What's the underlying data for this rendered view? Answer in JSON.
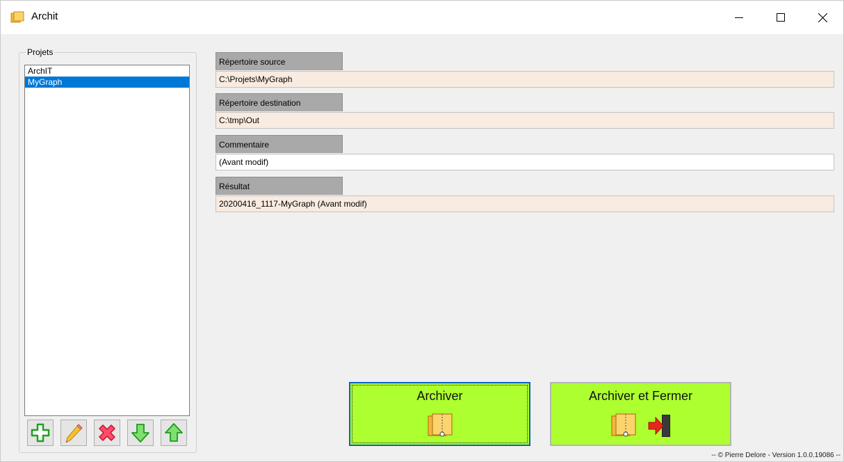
{
  "window": {
    "title": "Archit",
    "minimize_icon": "minimize-icon",
    "maximize_icon": "maximize-icon",
    "close_icon": "close-icon"
  },
  "projects": {
    "label": "Projets",
    "items": [
      {
        "label": "ArchIT",
        "selected": false
      },
      {
        "label": "MyGraph",
        "selected": true
      }
    ],
    "toolbar": [
      {
        "name": "add-button",
        "icon": "plus-icon"
      },
      {
        "name": "edit-button",
        "icon": "pencil-icon"
      },
      {
        "name": "delete-button",
        "icon": "delete-x-icon"
      },
      {
        "name": "move-down-button",
        "icon": "arrow-down-icon"
      },
      {
        "name": "move-up-button",
        "icon": "arrow-up-icon"
      }
    ]
  },
  "fields": {
    "source": {
      "label": "Répertoire source",
      "value": "C:\\Projets\\MyGraph"
    },
    "destination": {
      "label": "Répertoire destination",
      "value": "C:\\tmp\\Out"
    },
    "comment": {
      "label": "Commentaire",
      "value": "(Avant modif)"
    },
    "result": {
      "label": "Résultat",
      "value": "20200416_1117-MyGraph (Avant modif)"
    }
  },
  "actions": {
    "archive_label": "Archiver",
    "archive_close_label": "Archiver et Fermer"
  },
  "footer": "-- © Pierre Delore - Version 1.0.0.19086 --",
  "colors": {
    "accent_green": "#adff2f",
    "selection_blue": "#0078d7",
    "field_tab_gray": "#a9a9a9",
    "field_readonly_bg": "#f9ebe0"
  }
}
